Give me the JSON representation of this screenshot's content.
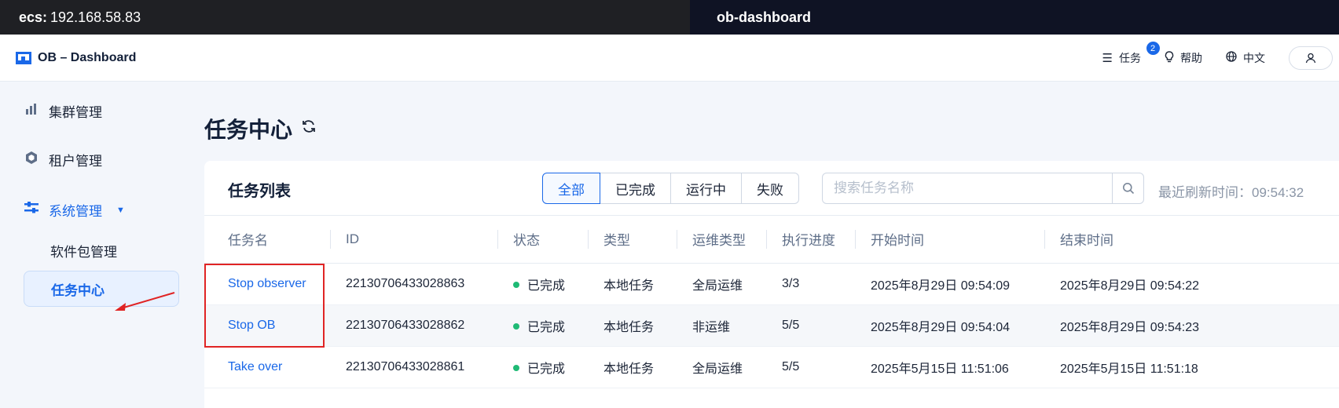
{
  "topbar": {
    "host_label": "ecs:",
    "host_ip": "192.168.58.83",
    "tab_title": "ob-dashboard"
  },
  "header": {
    "logo_text": "OB – Dashboard",
    "tasks_label": "任务",
    "tasks_badge": "2",
    "help_label": "帮助",
    "lang_label": "中文"
  },
  "sidebar": {
    "cluster": "集群管理",
    "tenant": "租户管理",
    "system": "系统管理",
    "software": "软件包管理",
    "task_center": "任务中心"
  },
  "page": {
    "title": "任务中心"
  },
  "card": {
    "title": "任务列表",
    "filters": [
      "全部",
      "已完成",
      "运行中",
      "失败"
    ],
    "active_filter": "全部",
    "search_placeholder": "搜索任务名称",
    "refresh_text": "最近刷新时间：09:54:32"
  },
  "table": {
    "columns": [
      "任务名",
      "ID",
      "状态",
      "类型",
      "运维类型",
      "执行进度",
      "开始时间",
      "结束时间"
    ],
    "rows": [
      {
        "name": "Stop observer",
        "id": "22130706433028863",
        "status": "已完成",
        "type": "本地任务",
        "ops_type": "全局运维",
        "progress": "3/3",
        "start": "2025年8月29日 09:54:09",
        "end": "2025年8月29日 09:54:22"
      },
      {
        "name": "Stop OB",
        "id": "22130706433028862",
        "status": "已完成",
        "type": "本地任务",
        "ops_type": "非运维",
        "progress": "5/5",
        "start": "2025年8月29日 09:54:04",
        "end": "2025年8月29日 09:54:23"
      },
      {
        "name": "Take over",
        "id": "22130706433028861",
        "status": "已完成",
        "type": "本地任务",
        "ops_type": "全局运维",
        "progress": "5/5",
        "start": "2025年5月15日 11:51:06",
        "end": "2025年5月15日 11:51:18"
      }
    ]
  },
  "colors": {
    "accent": "#1a68e8",
    "success": "#1fba75",
    "annotation": "#e02424"
  }
}
